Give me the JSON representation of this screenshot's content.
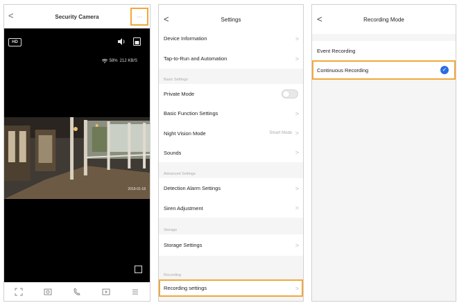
{
  "camera": {
    "title": "Security Camera",
    "back_glyph": "<",
    "more_glyph": "···",
    "hd_label": "HD",
    "wifi_text": "58%",
    "bitrate_text": "212 KB/S",
    "video_timestamp": "2019-01-18",
    "toolbar_icons": [
      "fullscreen-icon",
      "screenshot-icon",
      "talk-icon",
      "record-icon",
      "more-icon"
    ]
  },
  "settings": {
    "title": "Settings",
    "back_glyph": "<",
    "chev": ">",
    "items": {
      "device_information": "Device Information",
      "tap_to_run": "Tap-to-Run and Automation",
      "private_mode": "Private Mode",
      "basic_function": "Basic Function Settings",
      "night_vision": "Night Vision Mode",
      "night_vision_value": "Smart Mode",
      "sounds": "Sounds",
      "detection_alarm": "Detection Alarm Settings",
      "siren": "Siren Adjustment",
      "storage_settings": "Storage Settings",
      "recording_settings": "Recording settings"
    },
    "sections": {
      "basic": "Basic Settings",
      "advanced": "Advanced Settings",
      "storage": "Storage",
      "recording": "Recording"
    },
    "private_mode_on": false
  },
  "recording_mode": {
    "title": "Recording Mode",
    "back_glyph": "<",
    "options": [
      "Event Recording",
      "Continuous Recording"
    ],
    "selected_index": 1,
    "check_glyph": "✓"
  },
  "colors": {
    "highlight": "#f2a73b",
    "accent_blue": "#2d6cdf"
  }
}
